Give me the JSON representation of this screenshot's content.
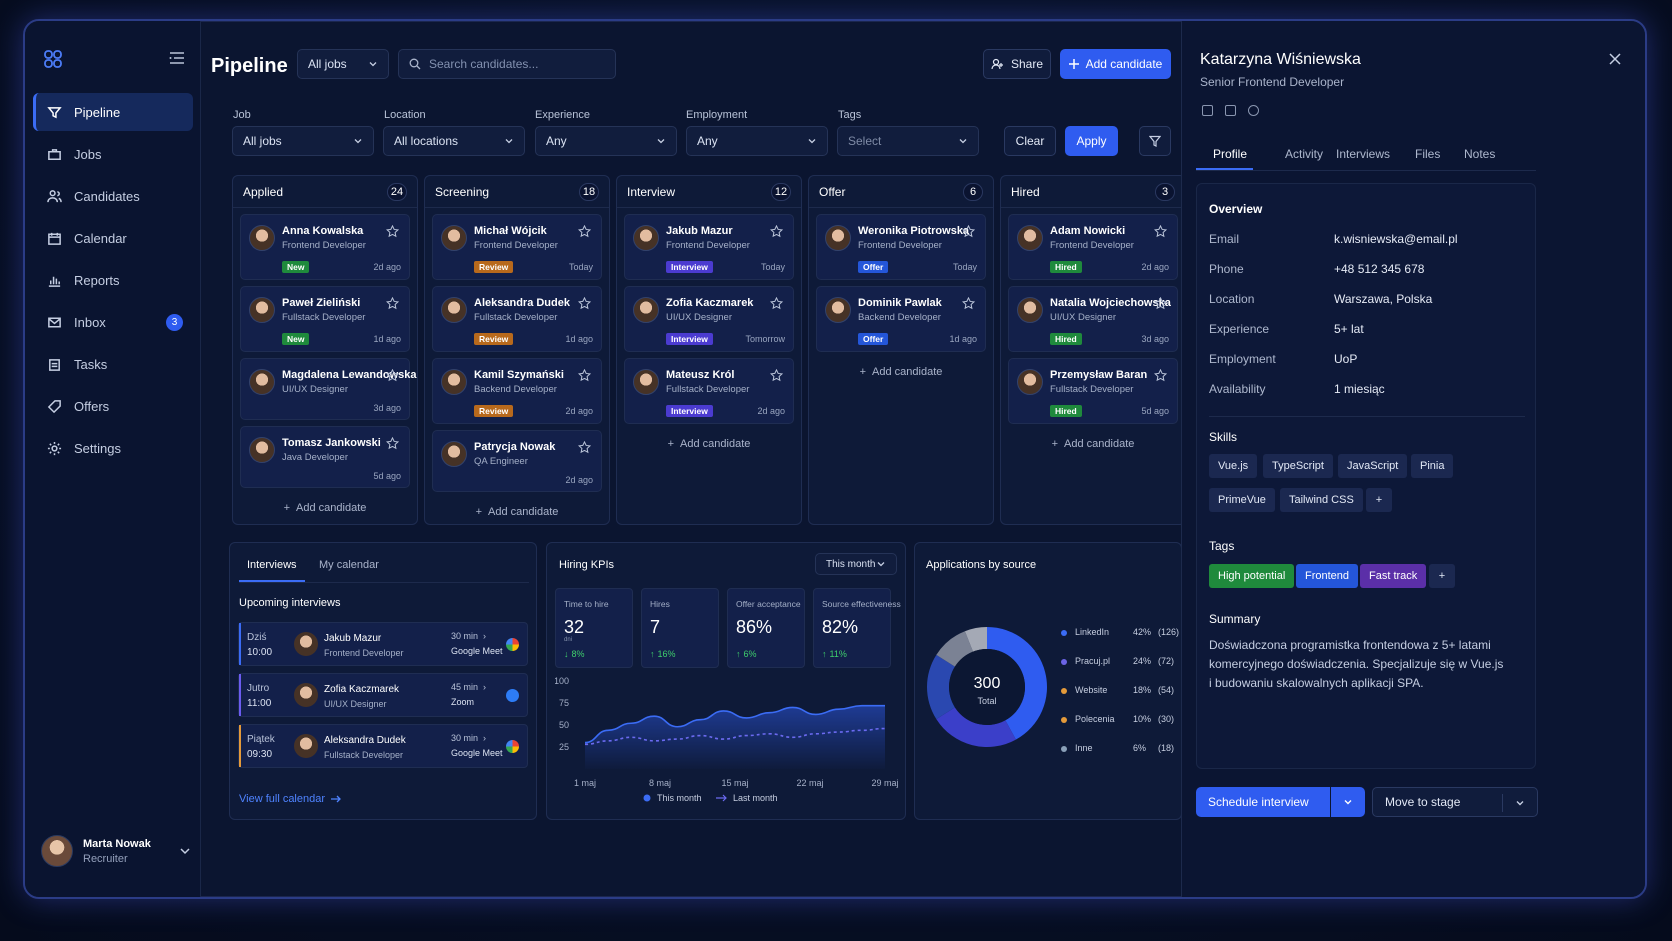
{
  "colors": {
    "accent": "#2f5cf0",
    "background": "#0b1530",
    "success": "#1f8a3c",
    "warning": "#b8691c",
    "interview": "#4b3bd0"
  },
  "sidebar": {
    "items": [
      {
        "label": "Pipeline",
        "icon": "filter-icon"
      },
      {
        "label": "Jobs",
        "icon": "briefcase-icon"
      },
      {
        "label": "Candidates",
        "icon": "users-icon"
      },
      {
        "label": "Calendar",
        "icon": "calendar-icon"
      },
      {
        "label": "Reports",
        "icon": "bar-chart-icon"
      },
      {
        "label": "Inbox",
        "icon": "mail-icon",
        "badge": "3"
      },
      {
        "label": "Tasks",
        "icon": "clipboard-icon"
      },
      {
        "label": "Offers",
        "icon": "tag-icon"
      },
      {
        "label": "Settings",
        "icon": "gear-icon"
      }
    ],
    "user": {
      "name": "Marta Nowak",
      "role": "Recruiter"
    }
  },
  "header": {
    "title": "Pipeline",
    "jobs_select": "All jobs",
    "search_placeholder": "Search candidates...",
    "share_label": "Share",
    "add_label": "Add candidate"
  },
  "filters": {
    "job": {
      "label": "Job",
      "value": "All jobs"
    },
    "location": {
      "label": "Location",
      "value": "All locations"
    },
    "experience": {
      "label": "Experience",
      "value": "Any"
    },
    "employment": {
      "label": "Employment",
      "value": "Any"
    },
    "tags": {
      "label": "Tags",
      "value": "Select"
    },
    "clear_label": "Clear",
    "apply_label": "Apply"
  },
  "columns": [
    {
      "title": "Applied",
      "count": "24",
      "add": "Add candidate",
      "cards": [
        {
          "name": "Anna Kowalska",
          "role": "Frontend Developer",
          "tag": "New",
          "tag_class": "tag-new",
          "time": "2d ago"
        },
        {
          "name": "Paweł Zieliński",
          "role": "Fullstack Developer",
          "tag": "New",
          "tag_class": "tag-new",
          "time": "1d ago"
        },
        {
          "name": "Magdalena Lewandowska",
          "role": "UI/UX Designer",
          "tag": "",
          "tag_class": "",
          "time": "3d ago"
        },
        {
          "name": "Tomasz Jankowski",
          "role": "Java Developer",
          "tag": "",
          "tag_class": "",
          "time": "5d ago"
        }
      ]
    },
    {
      "title": "Screening",
      "count": "18",
      "add": "Add candidate",
      "cards": [
        {
          "name": "Michał Wójcik",
          "role": "Frontend Developer",
          "tag": "Review",
          "tag_class": "tag-review",
          "time": "Today"
        },
        {
          "name": "Aleksandra Dudek",
          "role": "Fullstack Developer",
          "tag": "Review",
          "tag_class": "tag-review",
          "time": "1d ago"
        },
        {
          "name": "Kamil Szymański",
          "role": "Backend Developer",
          "tag": "Review",
          "tag_class": "tag-review",
          "time": "2d ago"
        },
        {
          "name": "Patrycja Nowak",
          "role": "QA Engineer",
          "tag": "",
          "tag_class": "",
          "time": "2d ago"
        }
      ]
    },
    {
      "title": "Interview",
      "count": "12",
      "add": "Add candidate",
      "cards": [
        {
          "name": "Jakub Mazur",
          "role": "Frontend Developer",
          "tag": "Interview",
          "tag_class": "tag-interview",
          "time": "Today"
        },
        {
          "name": "Zofia Kaczmarek",
          "role": "UI/UX Designer",
          "tag": "Interview",
          "tag_class": "tag-interview",
          "time": "Tomorrow"
        },
        {
          "name": "Mateusz Król",
          "role": "Fullstack Developer",
          "tag": "Interview",
          "tag_class": "tag-interview",
          "time": "2d ago"
        }
      ]
    },
    {
      "title": "Offer",
      "count": "6",
      "add": "Add candidate",
      "cards": [
        {
          "name": "Weronika Piotrowska",
          "role": "Frontend Developer",
          "tag": "Offer",
          "tag_class": "tag-offer",
          "time": "Today"
        },
        {
          "name": "Dominik Pawlak",
          "role": "Backend Developer",
          "tag": "Offer",
          "tag_class": "tag-offer",
          "time": "1d ago"
        }
      ]
    },
    {
      "title": "Hired",
      "count": "3",
      "add": "Add candidate",
      "cards": [
        {
          "name": "Adam Nowicki",
          "role": "Frontend Developer",
          "tag": "Hired",
          "tag_class": "tag-hired",
          "time": "2d ago"
        },
        {
          "name": "Natalia Wojciechowska",
          "role": "UI/UX Designer",
          "tag": "Hired",
          "tag_class": "tag-hired",
          "time": "3d ago"
        },
        {
          "name": "Przemysław Baran",
          "role": "Fullstack Developer",
          "tag": "Hired",
          "tag_class": "tag-hired",
          "time": "5d ago"
        }
      ]
    }
  ],
  "interviews": {
    "tab_active": "Interviews",
    "tab_other": "My calendar",
    "heading": "Upcoming interviews",
    "rows": [
      {
        "day": "Dziś",
        "time": "10:00",
        "name": "Jakub Mazur",
        "role": "Frontend Developer",
        "duration": "30 min",
        "platform": "Google Meet",
        "icon": "google-meet-icon"
      },
      {
        "day": "Jutro",
        "time": "11:00",
        "name": "Zofia Kaczmarek",
        "role": "UI/UX Designer",
        "duration": "45 min",
        "platform": "Zoom",
        "icon": "zoom-icon"
      },
      {
        "day": "Piątek",
        "time": "09:30",
        "name": "Aleksandra Dudek",
        "role": "Fullstack Developer",
        "duration": "30 min",
        "platform": "Google Meet",
        "icon": "google-meet-icon"
      }
    ],
    "link": "View full calendar"
  },
  "kpis": {
    "title": "Hiring KPIs",
    "period": "This month",
    "items": [
      {
        "label": "Time to hire",
        "value": "32",
        "sub": "dni",
        "delta": "8%",
        "dir": "down"
      },
      {
        "label": "Hires",
        "value": "7",
        "delta": "16%",
        "dir": "up"
      },
      {
        "label": "Offer acceptance",
        "value": "86%",
        "delta": "6%",
        "dir": "up"
      },
      {
        "label": "Source effectiveness",
        "value": "82%",
        "delta": "11%",
        "dir": "up"
      }
    ]
  },
  "chart_data": [
    {
      "type": "area",
      "x": [
        "1 maj",
        "8 maj",
        "15 maj",
        "22 maj",
        "29 maj"
      ],
      "y_ticks": [
        "100",
        "75",
        "50",
        "25"
      ],
      "ylim": [
        0,
        100
      ],
      "series": [
        {
          "name": "This month",
          "values": [
            30,
            44,
            52,
            60,
            48,
            56,
            66,
            58,
            64,
            70,
            62,
            68,
            72,
            72
          ],
          "color": "#3b6cf5"
        },
        {
          "name": "Last month",
          "values": [
            28,
            32,
            36,
            32,
            34,
            38,
            34,
            38,
            40,
            36,
            40,
            42,
            44,
            46
          ],
          "color": "#6b6af0",
          "dashed": true
        }
      ]
    },
    {
      "type": "pie",
      "title": "Applications by source",
      "center_value": "300",
      "center_label": "Total",
      "slices": [
        {
          "name": "LinkedIn",
          "percent": "42%",
          "count": "(126)",
          "value": 126,
          "color": "#2f5cf0"
        },
        {
          "name": "Pracuj.pl",
          "percent": "24%",
          "count": "(72)",
          "value": 72,
          "color": "#3b3fc9"
        },
        {
          "name": "Website",
          "percent": "18%",
          "count": "(54)",
          "value": 54,
          "color": "#2a48b0"
        },
        {
          "name": "Polecenia",
          "percent": "10%",
          "count": "(30)",
          "value": 30,
          "color": "#7b8294"
        },
        {
          "name": "Inne",
          "percent": "6%",
          "count": "(18)",
          "value": 18,
          "color": "#a4a9b5"
        }
      ],
      "legend_colors": [
        "#3b6cf5",
        "#6c64e6",
        "#e49a3a",
        "#e49a3a",
        "#8aa0b8"
      ]
    }
  ],
  "detail": {
    "name": "Katarzyna Wiśniewska",
    "title": "Senior Frontend Developer",
    "tabs": [
      "Profile",
      "Activity",
      "Interviews",
      "Files",
      "Notes"
    ],
    "overview_heading": "Overview",
    "fields": [
      {
        "k": "Email",
        "v": "k.wisniewska@email.pl"
      },
      {
        "k": "Phone",
        "v": "+48 512 345 678"
      },
      {
        "k": "Location",
        "v": "Warszawa, Polska"
      },
      {
        "k": "Experience",
        "v": "5+ lat"
      },
      {
        "k": "Employment",
        "v": "UoP"
      },
      {
        "k": "Availability",
        "v": "1 miesiąc"
      }
    ],
    "skills_heading": "Skills",
    "skills": [
      "Vue.js",
      "TypeScript",
      "JavaScript",
      "Pinia",
      "PrimeVue",
      "Tailwind CSS"
    ],
    "tags_heading": "Tags",
    "tags": [
      {
        "label": "High potential",
        "color": "#1f8a3c"
      },
      {
        "label": "Frontend",
        "color": "#2456d9"
      },
      {
        "label": "Fast track",
        "color": "#5b2fa8"
      }
    ],
    "summary_heading": "Summary",
    "summary": "Doświadczona programistka frontendowa z 5+ latami komercyjnego doświadczenia. Specjalizuje się w Vue.js i budowaniu skalowalnych aplikacji SPA.",
    "schedule_label": "Schedule interview",
    "move_label": "Move to stage",
    "add_symbol": "+"
  }
}
